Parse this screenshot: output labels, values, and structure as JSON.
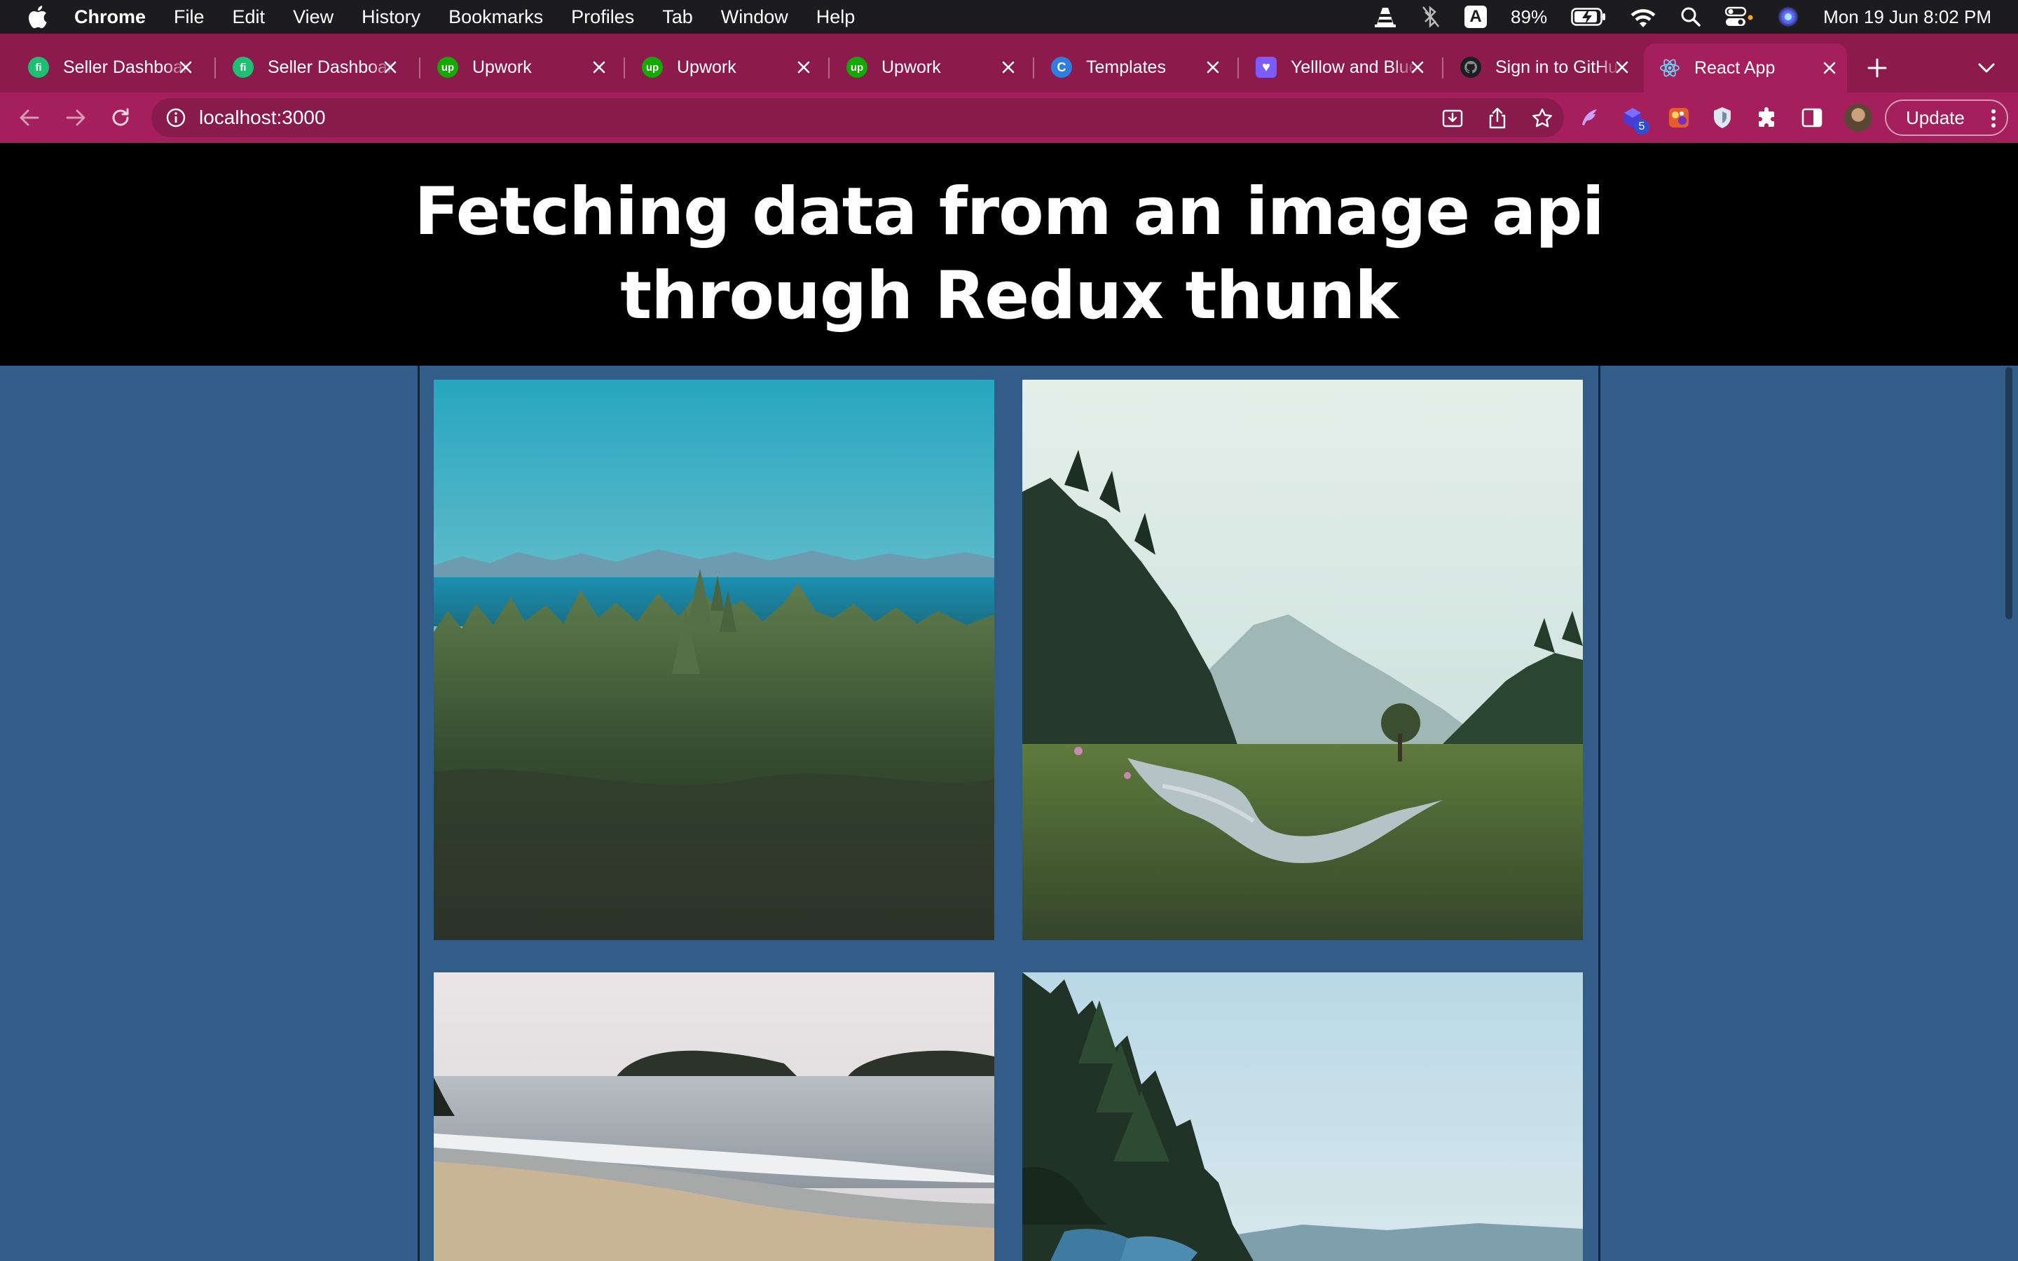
{
  "menubar": {
    "app_name": "Chrome",
    "items": [
      "File",
      "Edit",
      "View",
      "History",
      "Bookmarks",
      "Profiles",
      "Tab",
      "Window",
      "Help"
    ],
    "battery": "89%",
    "input_source": "A",
    "datetime": "Mon 19 Jun  8:02 PM"
  },
  "tabs": [
    {
      "title": "Seller Dashboard",
      "favicon": "fiverr-icon",
      "favicon_text": "fi",
      "color": "#1dbf73"
    },
    {
      "title": "Seller Dashboard",
      "favicon": "fiverr-icon",
      "favicon_text": "fi",
      "color": "#1dbf73"
    },
    {
      "title": "Upwork",
      "favicon": "upwork-icon",
      "favicon_text": "up",
      "color": "#14a800"
    },
    {
      "title": "Upwork",
      "favicon": "upwork-icon",
      "favicon_text": "up",
      "color": "#14a800"
    },
    {
      "title": "Upwork",
      "favicon": "upwork-icon",
      "favicon_text": "up",
      "color": "#14a800"
    },
    {
      "title": "Templates",
      "favicon": "canva-icon",
      "favicon_text": "C",
      "color": "#2f7de1"
    },
    {
      "title": "Yelllow and Blue",
      "favicon": "heart-icon",
      "favicon_text": "♥",
      "color": "#7b5cff"
    },
    {
      "title": "Sign in to GitHub",
      "favicon": "github-icon",
      "favicon_text": "",
      "color": "#1b1f23"
    },
    {
      "title": "React App",
      "favicon": "react-icon",
      "favicon_text": "",
      "color": "#61dafb",
      "active": true
    }
  ],
  "toolbar": {
    "url": "localhost:3000",
    "update_label": "Update",
    "extension_badge": "5"
  },
  "page": {
    "heading": "Fetching data from an image api through Redux thunk",
    "photos": [
      "forest-lake-photo",
      "river-valley-photo",
      "beach-islands-photo",
      "coastal-trees-photo"
    ]
  },
  "colors": {
    "tab_strip": "#8c1a4c",
    "active_tab": "#a51f5c",
    "page_background": "#325d88",
    "header_background": "#000000"
  }
}
